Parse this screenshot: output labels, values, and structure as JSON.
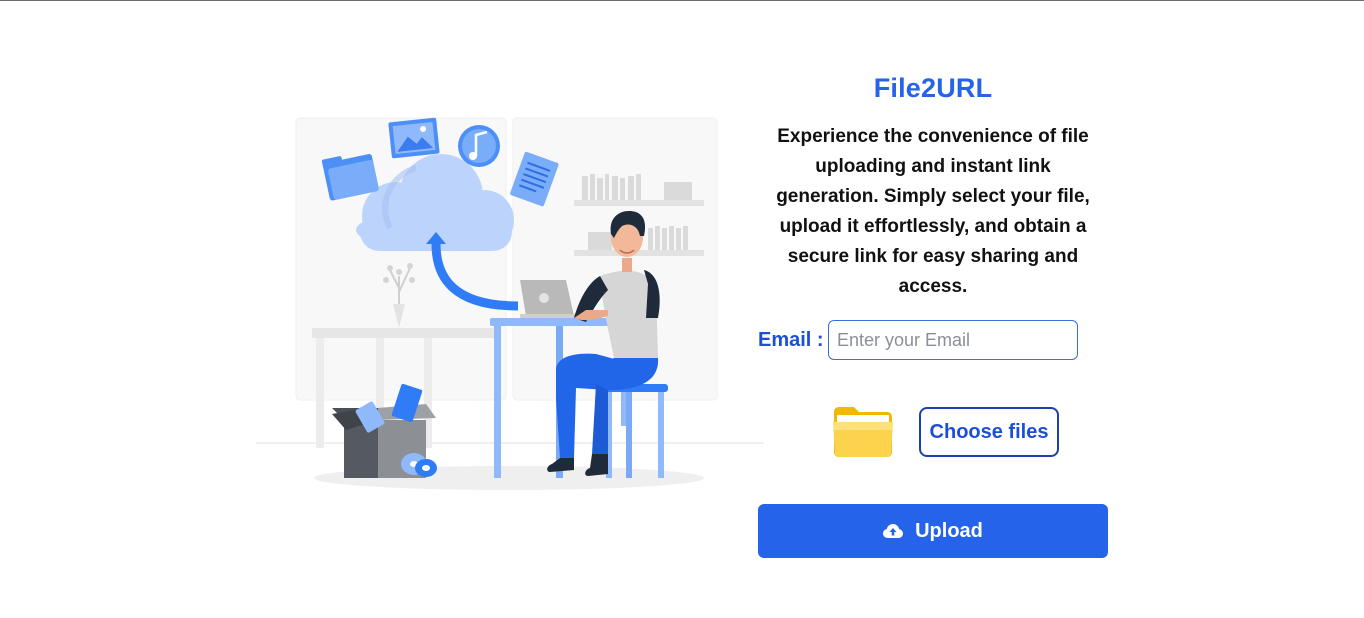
{
  "app": {
    "title": "File2URL",
    "description": "Experience the convenience of file uploading and instant link generation. Simply select your file, upload it effortlessly, and obtain a secure link for easy sharing and access."
  },
  "form": {
    "email_label": "Email :",
    "email_placeholder": "Enter your Email",
    "email_value": "",
    "choose_files_label": "Choose files",
    "upload_label": "Upload"
  },
  "icons": {
    "folder": "folder-icon",
    "upload": "cloud-upload-icon"
  },
  "colors": {
    "accent": "#2563eb",
    "label": "#1d4ed8",
    "folder": "#fcd34d"
  }
}
